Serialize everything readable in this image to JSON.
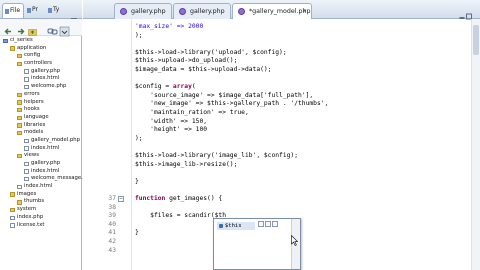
{
  "explorer": {
    "tabs": [
      {
        "label": "File",
        "active": true
      },
      {
        "label": "Pr",
        "active": false
      },
      {
        "label": "Ty",
        "active": false
      }
    ],
    "tree": [
      {
        "label": "ci_series",
        "type": "project",
        "depth": 0
      },
      {
        "label": "application",
        "type": "folder",
        "depth": 1
      },
      {
        "label": "config",
        "type": "folder",
        "depth": 2
      },
      {
        "label": "controllers",
        "type": "folder",
        "depth": 2
      },
      {
        "label": "gallery.php",
        "type": "file",
        "depth": 3
      },
      {
        "label": "index.html",
        "type": "file",
        "depth": 3
      },
      {
        "label": "welcome.php",
        "type": "file",
        "depth": 3
      },
      {
        "label": "errors",
        "type": "folder",
        "depth": 2
      },
      {
        "label": "helpers",
        "type": "folder",
        "depth": 2
      },
      {
        "label": "hooks",
        "type": "folder",
        "depth": 2
      },
      {
        "label": "language",
        "type": "folder",
        "depth": 2
      },
      {
        "label": "libraries",
        "type": "folder",
        "depth": 2
      },
      {
        "label": "models",
        "type": "folder",
        "depth": 2
      },
      {
        "label": "gallery_model.php",
        "type": "file",
        "depth": 3
      },
      {
        "label": "index.html",
        "type": "file",
        "depth": 3
      },
      {
        "label": "views",
        "type": "folder",
        "depth": 2
      },
      {
        "label": "gallery.php",
        "type": "file",
        "depth": 3
      },
      {
        "label": "index.html",
        "type": "file",
        "depth": 3
      },
      {
        "label": "welcome_message.php",
        "type": "file",
        "depth": 3
      },
      {
        "label": "index.html",
        "type": "file",
        "depth": 2
      },
      {
        "label": "images",
        "type": "folder",
        "depth": 1
      },
      {
        "label": "thumbs",
        "type": "folder",
        "depth": 2
      },
      {
        "label": "system",
        "type": "folder",
        "depth": 1
      },
      {
        "label": "index.php",
        "type": "file",
        "depth": 1
      },
      {
        "label": "license.txt",
        "type": "file",
        "depth": 1
      }
    ]
  },
  "editor": {
    "tabs": [
      {
        "label": "gallery.php",
        "active": false
      },
      {
        "label": "gallery.php",
        "active": false
      },
      {
        "label": "*gallery_model.php",
        "active": true
      }
    ],
    "lines": [
      {
        "num": "",
        "fold": false,
        "segments": [
          {
            "t": "'max_size' => 2000",
            "c": "str"
          }
        ]
      },
      {
        "num": "",
        "fold": false,
        "segments": [
          {
            "t": ");",
            "c": "plain"
          }
        ]
      },
      {
        "num": "",
        "fold": false,
        "segments": []
      },
      {
        "num": "",
        "fold": false,
        "segments": [
          {
            "t": "$this->load->library('upload', $config);",
            "c": "plain"
          }
        ]
      },
      {
        "num": "",
        "fold": false,
        "segments": [
          {
            "t": "$this->upload->do_upload();",
            "c": "plain"
          }
        ]
      },
      {
        "num": "",
        "fold": false,
        "segments": [
          {
            "t": "$image_data = $this->upload->data();",
            "c": "plain"
          }
        ]
      },
      {
        "num": "",
        "fold": false,
        "segments": []
      },
      {
        "num": "",
        "fold": false,
        "segments": [
          {
            "t": "$config = ",
            "c": "plain"
          },
          {
            "t": "array",
            "c": "kw"
          },
          {
            "t": "(",
            "c": "plain"
          }
        ]
      },
      {
        "num": "",
        "fold": false,
        "segments": [
          {
            "t": "    'source_image' => $image_data['full_path'],",
            "c": "plain"
          }
        ]
      },
      {
        "num": "",
        "fold": false,
        "segments": [
          {
            "t": "    'new_image' => $this->gallery_path . '/thumbs',",
            "c": "plain"
          }
        ]
      },
      {
        "num": "",
        "fold": false,
        "segments": [
          {
            "t": "    'maintain_ration' => true,",
            "c": "plain"
          }
        ]
      },
      {
        "num": "",
        "fold": false,
        "segments": [
          {
            "t": "    'width' => 150,",
            "c": "plain"
          }
        ]
      },
      {
        "num": "",
        "fold": false,
        "segments": [
          {
            "t": "    'height' => 100",
            "c": "plain"
          }
        ]
      },
      {
        "num": "",
        "fold": false,
        "segments": [
          {
            "t": ");",
            "c": "plain"
          }
        ]
      },
      {
        "num": "",
        "fold": false,
        "segments": []
      },
      {
        "num": "",
        "fold": false,
        "segments": [
          {
            "t": "$this->load->library('image_lib', $config);",
            "c": "plain"
          }
        ]
      },
      {
        "num": "",
        "fold": false,
        "segments": [
          {
            "t": "$this->image_lib->resize();",
            "c": "plain"
          }
        ]
      },
      {
        "num": "",
        "fold": false,
        "segments": []
      },
      {
        "num": "",
        "fold": false,
        "segments": [
          {
            "t": "}",
            "c": "plain"
          }
        ]
      },
      {
        "num": "",
        "fold": false,
        "segments": []
      },
      {
        "num": "37",
        "fold": true,
        "segments": [
          {
            "t": "function",
            "c": "kw"
          },
          {
            "t": " get_images() {",
            "c": "plain"
          }
        ]
      },
      {
        "num": "38",
        "fold": false,
        "segments": []
      },
      {
        "num": "39",
        "fold": false,
        "segments": [
          {
            "t": "    $files = scandir($th",
            "c": "plain"
          }
        ]
      },
      {
        "num": "40",
        "fold": false,
        "segments": []
      },
      {
        "num": "41",
        "fold": false,
        "segments": [
          {
            "t": "}",
            "c": "plain"
          }
        ]
      },
      {
        "num": "42",
        "fold": false,
        "segments": []
      },
      {
        "num": "43",
        "fold": false,
        "segments": []
      }
    ]
  },
  "autocomplete": {
    "items": [
      {
        "label": "$this"
      }
    ]
  }
}
